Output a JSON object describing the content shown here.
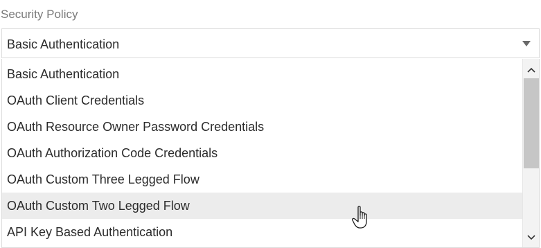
{
  "field": {
    "label": "Security Policy",
    "selected_value": "Basic Authentication"
  },
  "dropdown": {
    "options": [
      {
        "label": "Basic Authentication"
      },
      {
        "label": "OAuth Client Credentials"
      },
      {
        "label": "OAuth Resource Owner Password Credentials"
      },
      {
        "label": "OAuth Authorization Code Credentials"
      },
      {
        "label": "OAuth Custom Three Legged Flow"
      },
      {
        "label": "OAuth Custom Two Legged Flow"
      },
      {
        "label": "API Key Based Authentication"
      }
    ],
    "hovered_option": "OAuth Custom Two Legged Flow",
    "scroll_position": 0.0
  },
  "colors": {
    "hover_background": "#ececec",
    "label_gray": "#7a7a7a",
    "text": "#2b2b2b",
    "scrollbar_thumb": "#c6c6c6"
  },
  "icons": {
    "caret": "chevron-down-icon",
    "scroll_up": "chevron-up-icon",
    "scroll_down": "chevron-down-icon",
    "cursor": "hand-pointer-icon"
  }
}
